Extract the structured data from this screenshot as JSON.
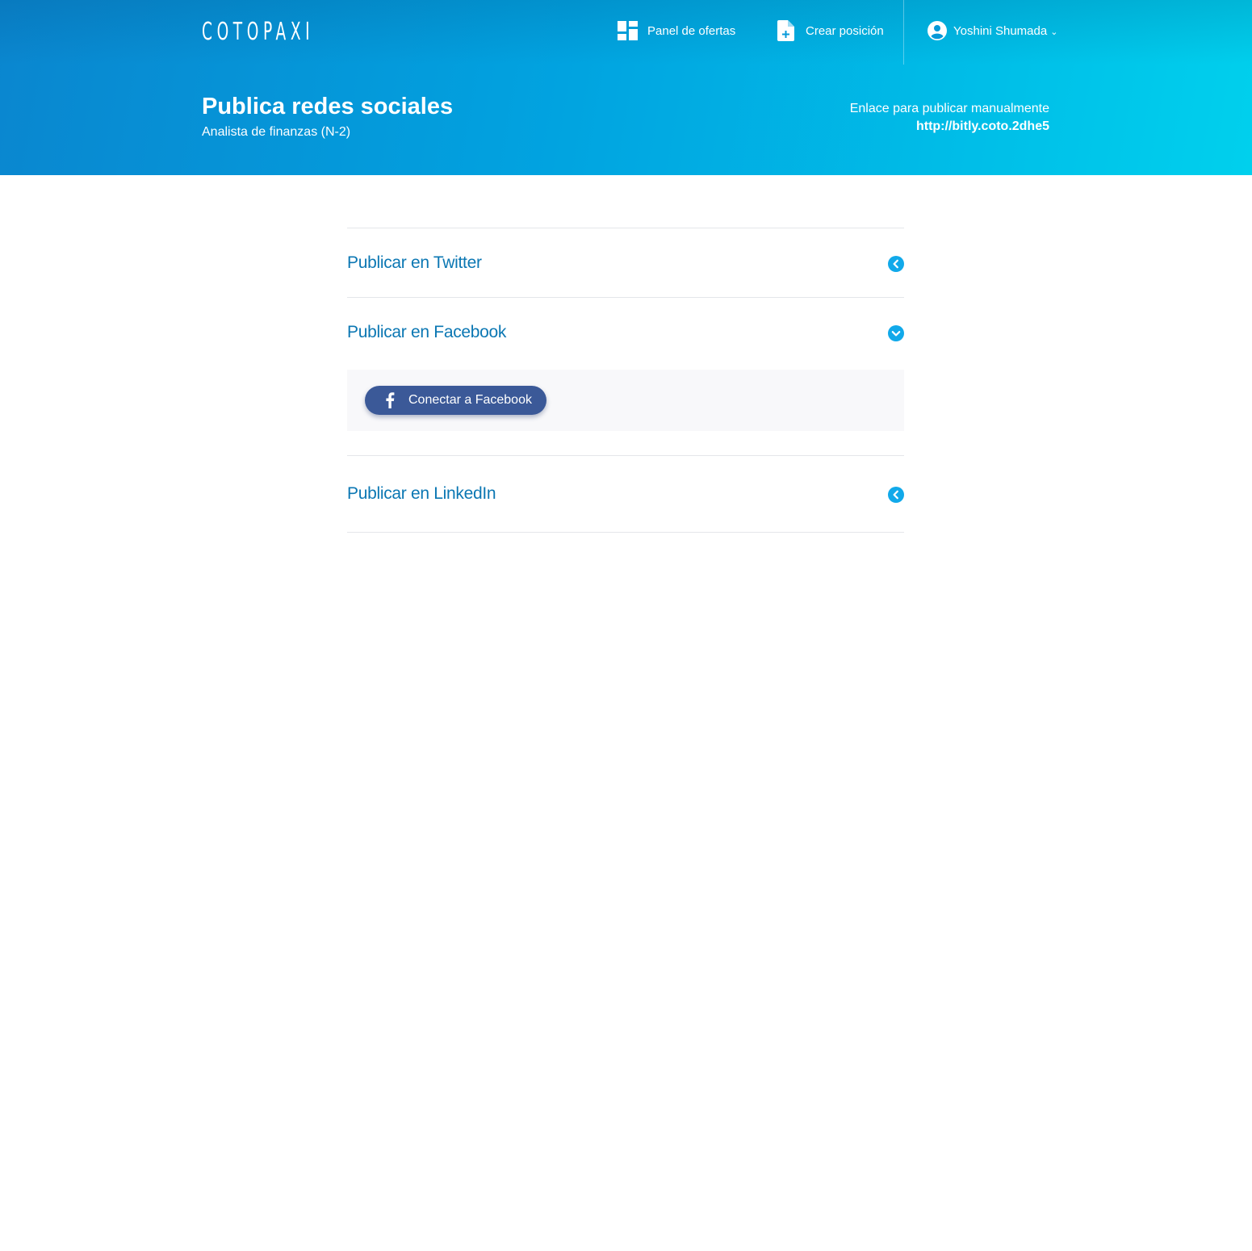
{
  "brand": {
    "logo_text": "COTOPAXI"
  },
  "nav": {
    "panel_label": "Panel de ofertas",
    "panel_icon": "dashboard-icon",
    "create_label": "Crear posición",
    "create_icon": "add-document-icon",
    "user_name": "Yoshini Shumada",
    "user_icon": "account-circle-icon",
    "user_chevron": "⌄"
  },
  "page": {
    "title": "Publica redes sociales",
    "subtitle": "Analista de finanzas (N-2)",
    "manual_link_label": "Enlace para publicar manualmente",
    "manual_link_url": "http://bitly.coto.2dhe5"
  },
  "sections": [
    {
      "title": "Publicar en Twitter",
      "expanded": false,
      "toggle_icon": "chevron-left-icon"
    },
    {
      "title": "Publicar en Facebook",
      "expanded": true,
      "toggle_icon": "chevron-down-icon",
      "action_label": "Conectar a Facebook",
      "action_icon": "facebook-icon"
    },
    {
      "title": "Publicar en LinkedIn",
      "expanded": false,
      "toggle_icon": "chevron-left-icon"
    }
  ],
  "colors": {
    "header_gradient_start": "#0a86cf",
    "header_gradient_end": "#00d0ed",
    "section_title": "#0b77b3",
    "toggle_accent": "#11a9ea",
    "facebook_blue": "#3b5998",
    "panel_background": "#f8f8fa"
  }
}
